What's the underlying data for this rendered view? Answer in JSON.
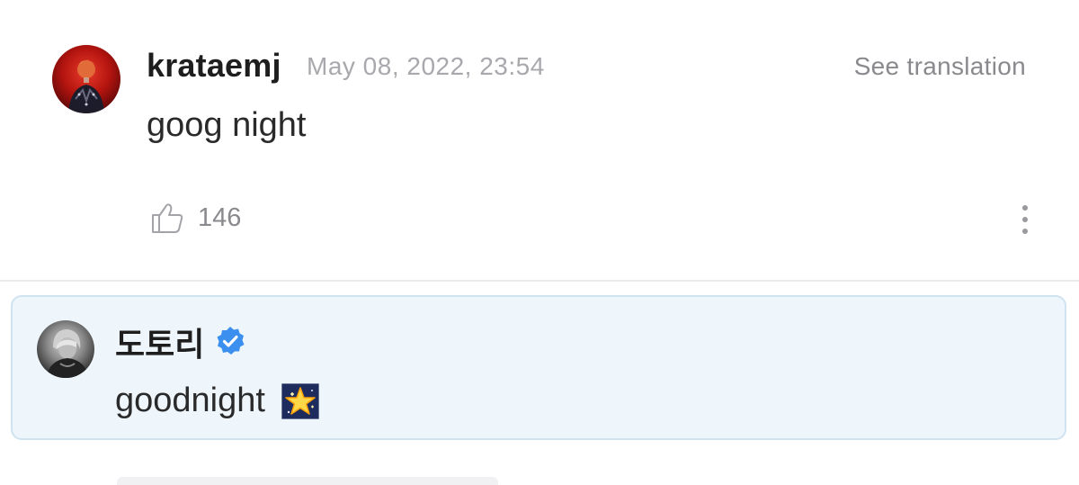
{
  "comment": {
    "username": "krataemj",
    "timestamp": "May 08, 2022, 23:54",
    "see_translation_label": "See translation",
    "body": "goog night",
    "like_count": "146",
    "avatar_icon": "user-avatar-red-stage",
    "like_icon": "thumbs-up-icon",
    "more_icon": "vertical-ellipsis-icon"
  },
  "reply": {
    "username": "도토리",
    "verified_icon": "verified-badge-icon",
    "body": "goodnight",
    "emoji": "glowing-star",
    "avatar_icon": "user-avatar-grayscale"
  },
  "colors": {
    "reply_background": "#eef6fc",
    "reply_border": "#cfe3f1",
    "verified_blue": "#3b8fef",
    "muted_text": "#8a8a8e"
  }
}
